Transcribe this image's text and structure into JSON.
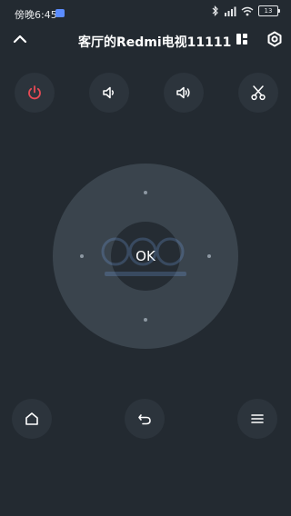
{
  "status_bar": {
    "time": "傍晚6:45",
    "battery_level": "13"
  },
  "header": {
    "title": "客厅的Redmi电视11111"
  },
  "remote": {
    "ok_label": "OK"
  },
  "icons": {
    "back": "chevron-up-icon",
    "layout": "layout-icon",
    "settings": "gear-icon",
    "power": "power-icon",
    "volume_down": "volume-down-icon",
    "volume_up": "volume-up-icon",
    "screenshot": "scissors-icon",
    "home": "home-icon",
    "return": "undo-icon",
    "menu": "menu-icon"
  },
  "colors": {
    "background": "#232a31",
    "button": "#2c343c",
    "power_accent": "#e84a55",
    "dpad_outer": "#3a444d",
    "dpad_inner": "#252c33"
  }
}
